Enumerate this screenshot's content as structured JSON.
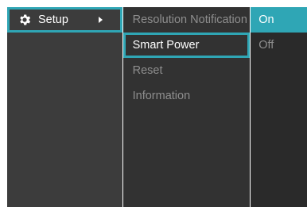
{
  "menu": {
    "main": [
      {
        "label": "Setup",
        "icon": "gear-icon"
      }
    ],
    "sub": [
      {
        "label": "Resolution Notification"
      },
      {
        "label": "Smart Power"
      },
      {
        "label": "Reset"
      },
      {
        "label": "Information"
      }
    ],
    "options": [
      {
        "label": "On"
      },
      {
        "label": "Off"
      }
    ]
  },
  "colors": {
    "accent": "#2fa6b5",
    "panel_main": "#3c3c3c",
    "panel_sub": "#323232",
    "panel_options": "#2a2a2a"
  }
}
